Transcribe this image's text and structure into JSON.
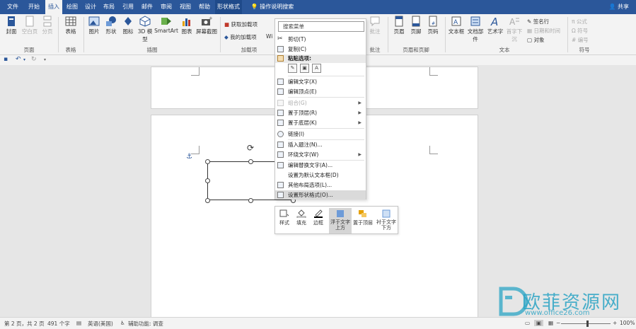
{
  "tabs": [
    "文件",
    "开始",
    "插入",
    "绘图",
    "设计",
    "布局",
    "引用",
    "邮件",
    "审阅",
    "视图",
    "帮助",
    "形状格式",
    "操作说明搜索"
  ],
  "share_label": "共享",
  "ribbon": {
    "pages": {
      "items": [
        "封面",
        "空白页",
        "分页"
      ],
      "label": "页面"
    },
    "tables": {
      "items": [
        "表格"
      ],
      "label": "表格"
    },
    "illustrations": {
      "items": [
        "图片",
        "形状",
        "图标",
        "3D 模型",
        "SmartArt",
        "图表",
        "屏幕截图"
      ],
      "label": "插图"
    },
    "addins": {
      "items": [
        "获取加载项",
        "我的加载项",
        "Wi"
      ],
      "label": "加载项"
    },
    "comments": {
      "items": [
        "批注"
      ],
      "label": "批注"
    },
    "header_footer": {
      "items": [
        "页眉",
        "页脚",
        "页码"
      ],
      "label": "页眉和页脚"
    },
    "text": {
      "items": [
        "文本框",
        "文档部件",
        "艺术字",
        "首字下沉"
      ],
      "small": [
        "签名行",
        "日期和时间",
        "对象"
      ],
      "label": "文本"
    },
    "symbols": {
      "items": [
        "公式",
        "符号",
        "编号"
      ],
      "label": "符号"
    }
  },
  "context_menu": {
    "search_placeholder": "搜索菜单",
    "items": [
      {
        "label": "剪切(T)",
        "disabled": false
      },
      {
        "label": "复制(C)",
        "disabled": false
      },
      {
        "label": "编辑文字(X)",
        "disabled": false
      },
      {
        "label": "编辑顶点(E)",
        "disabled": false
      },
      {
        "label": "组合(G)",
        "disabled": true
      },
      {
        "label": "置于顶层(R)",
        "disabled": false
      },
      {
        "label": "置于底层(K)",
        "disabled": false
      },
      {
        "label": "链接(I)",
        "disabled": false
      },
      {
        "label": "插入题注(N)...",
        "disabled": false
      },
      {
        "label": "环绕文字(W)",
        "disabled": false
      },
      {
        "label": "编辑替换文字(A)...",
        "disabled": false
      },
      {
        "label": "设置为默认文本框(D)",
        "disabled": false
      },
      {
        "label": "其他布局选项(L)...",
        "disabled": false
      },
      {
        "label": "设置形状格式(O)...",
        "disabled": false
      }
    ],
    "paste_header": "粘贴选项:"
  },
  "mini_toolbar": [
    "样式",
    "填充",
    "边框",
    "浮于文字上方",
    "置于顶层",
    "衬于文字下方"
  ],
  "status": {
    "page": "第 2 页，共 2 页",
    "words": "491 个字",
    "language": "英语(美国)",
    "accessibility": "辅助功能: 调查",
    "zoom": "100%"
  },
  "watermark": {
    "text": "欧菲资源网",
    "url": "www.office26.com"
  },
  "colors": {
    "accent": "#2b579a",
    "ribbon_bg": "#f3f3f3",
    "watermark": "#2ba4c4"
  }
}
